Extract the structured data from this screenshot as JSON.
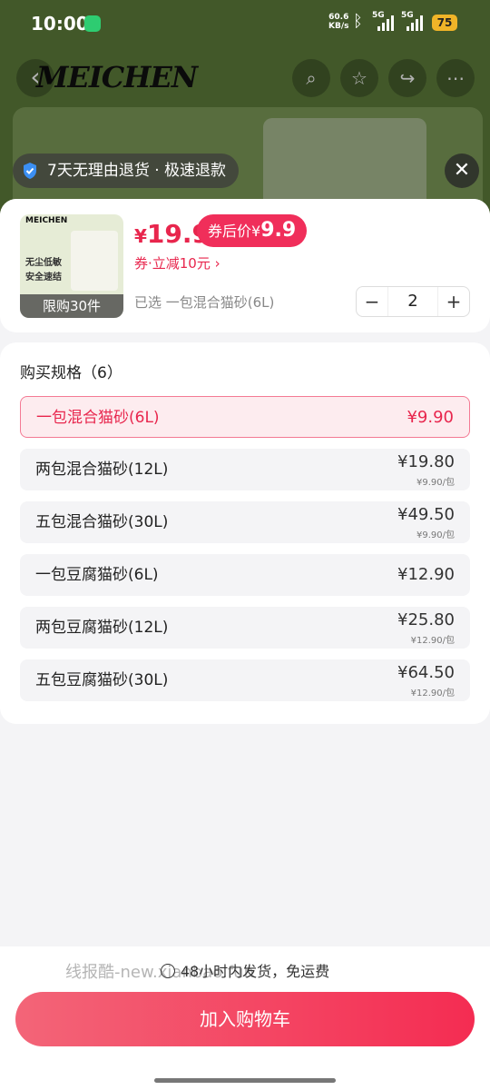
{
  "status_bar": {
    "time": "10:00",
    "net_speed_value": "60.6",
    "net_speed_unit": "KB/s",
    "signal1": "5G",
    "signal2": "5G",
    "battery": "75"
  },
  "background_page": {
    "brand": "MEICHEN"
  },
  "return_policy": {
    "text": "7天无理由退货 · 极速退款"
  },
  "product": {
    "thumb_brand": "MEICHEN",
    "thumb_line1": "无尘低敏",
    "thumb_line2": "安全速结",
    "limit_label": "限购30件",
    "price_currency": "¥",
    "price_value": "19.9",
    "coupon_tag_label": "券后价",
    "coupon_tag_currency": "¥",
    "coupon_tag_value": "9.9",
    "coupon_line": "券·立减10元",
    "selected_text": "已选 一包混合猫砂(6L)",
    "quantity": "2",
    "minus": "−",
    "plus": "+"
  },
  "specs": {
    "title": "购买规格（6）",
    "items": [
      {
        "name": "一包混合猫砂(6L)",
        "price": "¥9.90",
        "unit_price": "",
        "selected": true
      },
      {
        "name": "两包混合猫砂(12L)",
        "price": "¥19.80",
        "unit_price": "¥9.90/包",
        "selected": false
      },
      {
        "name": "五包混合猫砂(30L)",
        "price": "¥49.50",
        "unit_price": "¥9.90/包",
        "selected": false
      },
      {
        "name": "一包豆腐猫砂(6L)",
        "price": "¥12.90",
        "unit_price": "",
        "selected": false
      },
      {
        "name": "两包豆腐猫砂(12L)",
        "price": "¥25.80",
        "unit_price": "¥12.90/包",
        "selected": false
      },
      {
        "name": "五包豆腐猫砂(30L)",
        "price": "¥64.50",
        "unit_price": "¥12.90/包",
        "selected": false
      }
    ]
  },
  "footer": {
    "shipping": "48小时内发货，免运费",
    "watermark": "线报酷-new.xianbao.fun",
    "add_to_cart": "加入购物车"
  },
  "colors": {
    "accent": "#e8264d",
    "button_gradient_start": "#f36578",
    "button_gradient_end": "#f42c52"
  }
}
